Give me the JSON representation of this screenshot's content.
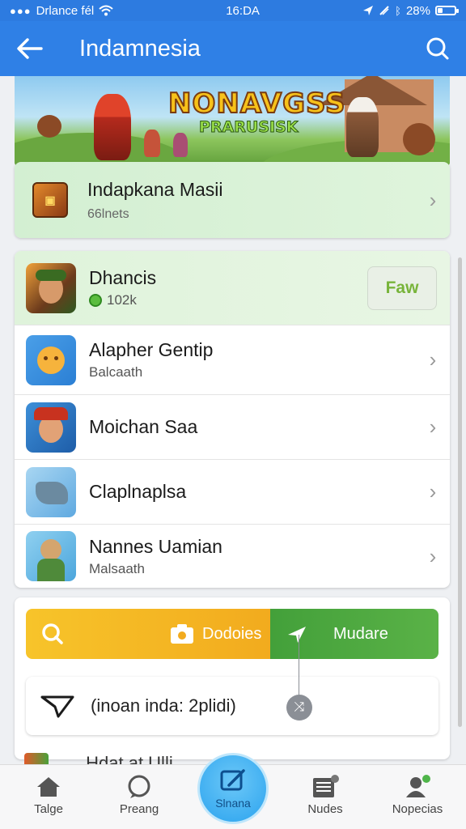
{
  "status_bar": {
    "carrier": "Drlance fél",
    "time": "16:DA",
    "battery_text": "28%",
    "battery_level": 0.28
  },
  "app_bar": {
    "title": "Indamnesia"
  },
  "banner": {
    "line1": "NONAVGSS",
    "line2": "PRARUSISK"
  },
  "featured": {
    "name": "Indapkana Masii",
    "sub": "66lnets"
  },
  "list": [
    {
      "title": "Dhancis",
      "sub": "102k",
      "action": "Faw"
    },
    {
      "title": "Alapher Gentip",
      "sub": "Balcaath"
    },
    {
      "title": "Moichan Saa",
      "sub": ""
    },
    {
      "title": "Claplnaplsa",
      "sub": ""
    },
    {
      "title": "Nannes Uamian",
      "sub": "Malsaath"
    }
  ],
  "actions": {
    "yellow_label": "Dodoies",
    "green_label": "Mudare"
  },
  "search": {
    "text": "(inoan inda: 2plidi)"
  },
  "peek_text": "Hdat at Ulli",
  "nav": [
    {
      "label": "Talge"
    },
    {
      "label": "Preang"
    },
    {
      "label": "Slnana"
    },
    {
      "label": "Nudes"
    },
    {
      "label": "Nopecias"
    }
  ],
  "colors": {
    "primary": "#2f80e6",
    "yellow": "#f7c42a",
    "green": "#43a03a",
    "fab": "#2ba3ee"
  }
}
